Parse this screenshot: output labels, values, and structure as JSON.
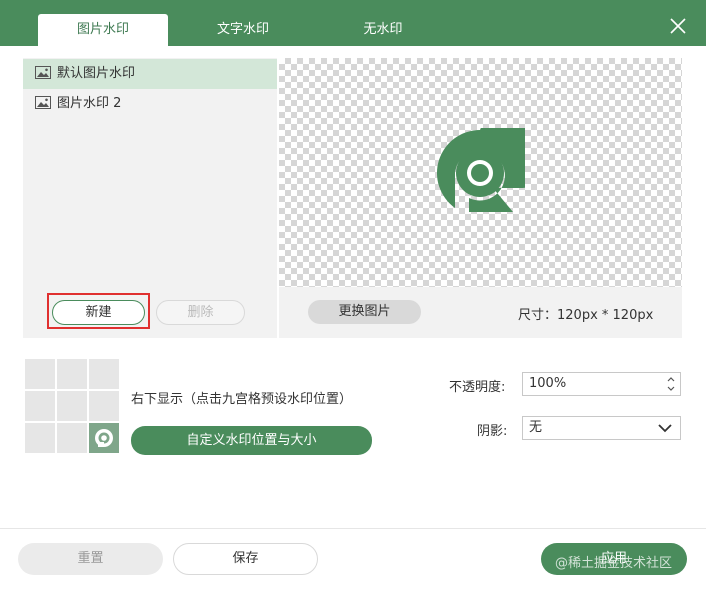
{
  "tabs": [
    {
      "label": "图片水印",
      "active": true
    },
    {
      "label": "文字水印",
      "active": false
    },
    {
      "label": "无水印",
      "active": false
    }
  ],
  "watermark_list": [
    {
      "label": "默认图片水印",
      "selected": true
    },
    {
      "label": "图片水印 2",
      "selected": false
    }
  ],
  "list_actions": {
    "new_label": "新建",
    "delete_label": "删除"
  },
  "preview": {
    "replace_label": "更换图片",
    "size_label": "尺寸：120px * 120px"
  },
  "position": {
    "description": "右下显示（点击九宫格预设水印位置）",
    "custom_label": "自定义水印位置与大小",
    "active_cell": 8
  },
  "opacity": {
    "label": "不透明度:",
    "value": "100%"
  },
  "shadow": {
    "label": "阴影:",
    "value": "无"
  },
  "footer": {
    "reset_label": "重置",
    "save_label": "保存",
    "apply_label": "应用",
    "overlay_text": "@稀土掘金技术社区"
  },
  "colors": {
    "brand": "#4a8c5c",
    "highlight": "#e0302f"
  }
}
